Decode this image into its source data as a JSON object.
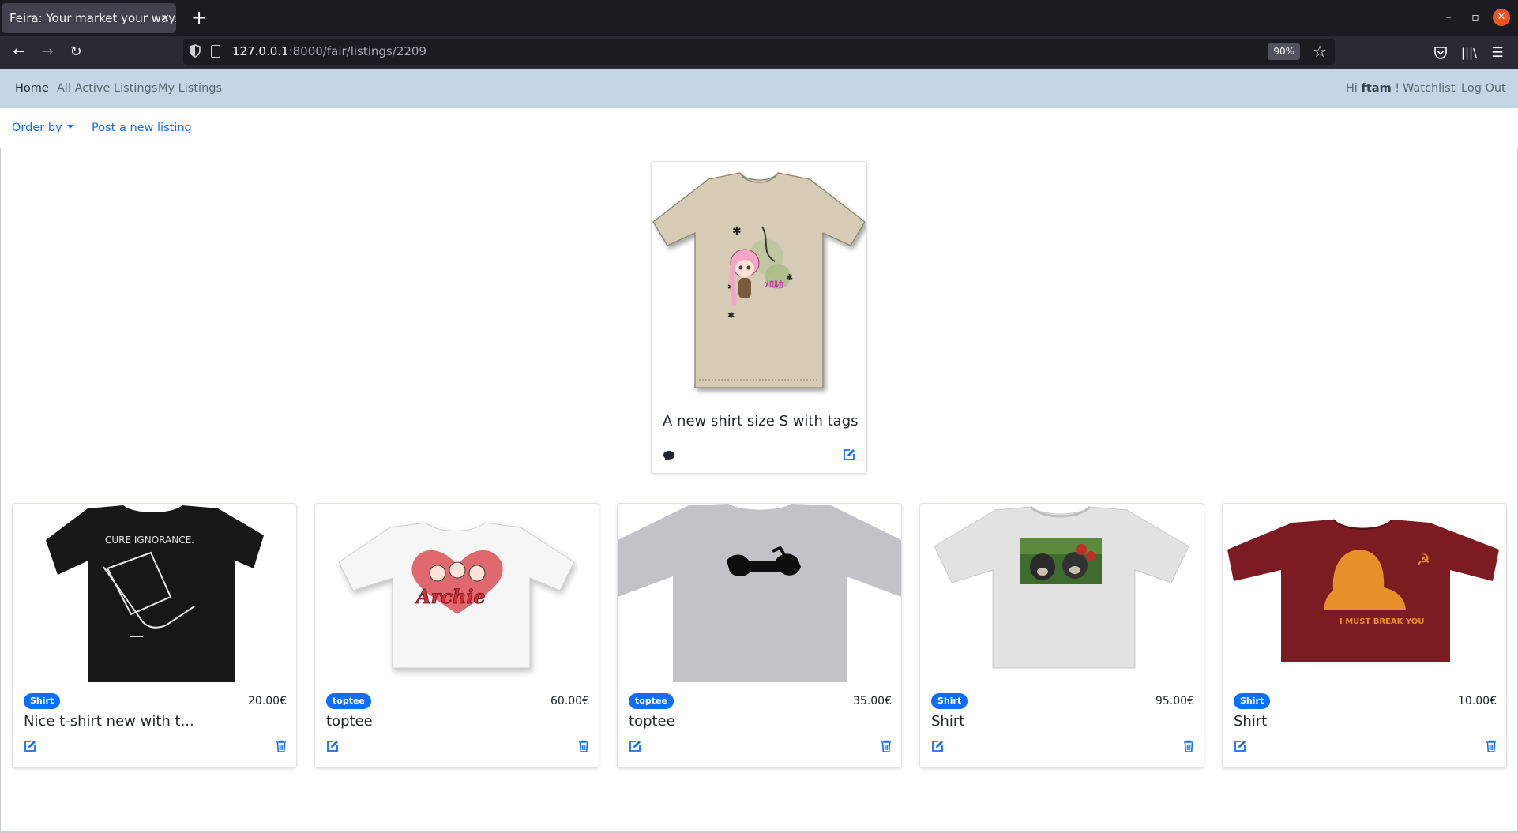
{
  "browser": {
    "tab_title": "Feira: Your market your way.",
    "tab_close": "×",
    "new_tab": "+",
    "url_host": "127.0.0.1",
    "url_path": ":8000/fair/listings/2209",
    "zoom": "90%",
    "icons": [
      "shield-icon",
      "page-icon",
      "star-icon",
      "pocket-icon",
      "library-icon",
      "menu-icon"
    ]
  },
  "nav": {
    "home": "Home",
    "all_listings": "All Active Listings",
    "my_listings": "My Listings",
    "greet_prefix": "Hi ",
    "username": "ftam",
    "greet_suffix": " !",
    "watchlist": "Watchlist",
    "logout": "Log Out"
  },
  "subnav": {
    "order_by": "Order by",
    "post_new": "Post a new listing"
  },
  "featured": {
    "title": "A new shirt size S with tags"
  },
  "listings": [
    {
      "category": "Shirt",
      "price": "20.00€",
      "title": "Nice t-shirt new with t..."
    },
    {
      "category": "toptee",
      "price": "60.00€",
      "title": "toptee"
    },
    {
      "category": "toptee",
      "price": "35.00€",
      "title": "toptee"
    },
    {
      "category": "Shirt",
      "price": "95.00€",
      "title": "Shirt"
    },
    {
      "category": "Shirt",
      "price": "10.00€",
      "title": "Shirt"
    }
  ],
  "shirt_texts": {
    "cure": "CURE IGNORANCE.",
    "archie": "Archie",
    "break": "I MUST BREAK YOU"
  },
  "colors": {
    "nav_bg": "#c4d6e6",
    "link": "#0d6efd",
    "badge": "#0d6efd"
  }
}
